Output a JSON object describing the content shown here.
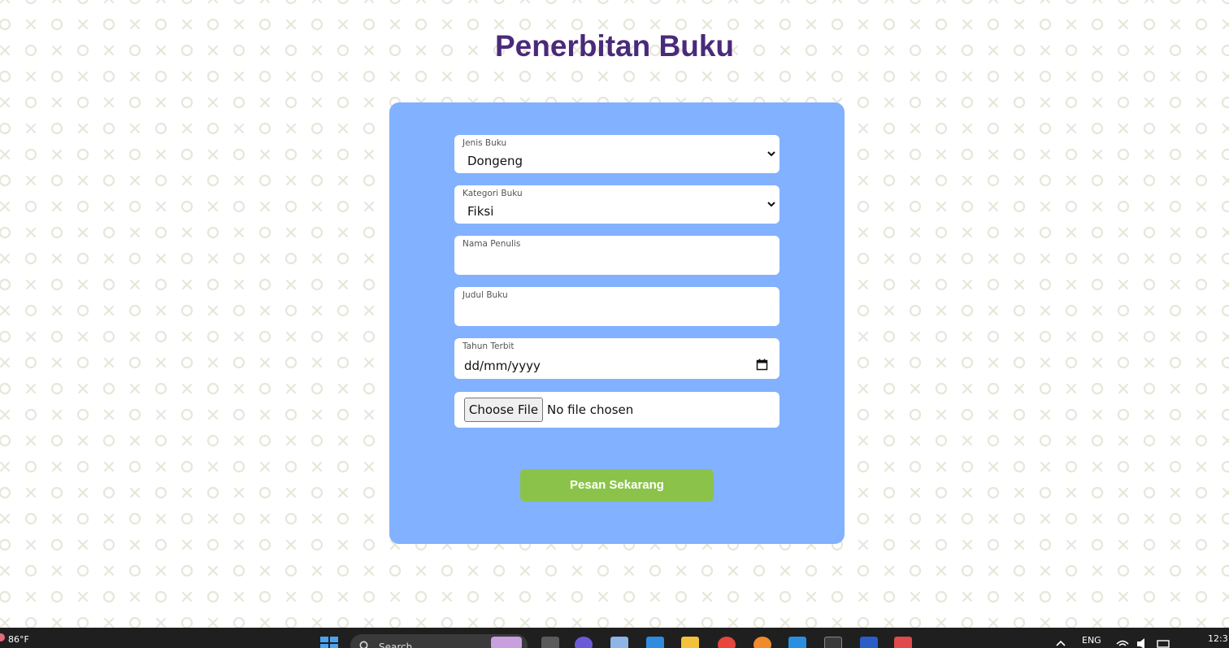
{
  "page": {
    "title": "Penerbitan Buku"
  },
  "form": {
    "jenis_buku": {
      "label": "Jenis Buku",
      "value": "Dongeng"
    },
    "kategori_buku": {
      "label": "Kategori Buku",
      "value": "Fiksi"
    },
    "nama_penulis": {
      "label": "Nama Penulis",
      "value": ""
    },
    "judul_buku": {
      "label": "Judul Buku",
      "value": ""
    },
    "tahun_terbit": {
      "label": "Tahun Terbit",
      "placeholder": "dd/mm/yyyy"
    },
    "file": {
      "button_label": "Choose File",
      "status": "No file chosen"
    },
    "submit_label": "Pesan Sekarang"
  },
  "colors": {
    "title": "#4a2a7a",
    "card": "#82b1ff",
    "submit": "#8bc34a",
    "pattern": "#e9e9dd"
  },
  "taskbar": {
    "weather": "86°F",
    "search_placeholder": "Search",
    "language": "ENG",
    "clock": "12:3",
    "apps": [
      "file-explorer-icon",
      "chat-icon",
      "photos-icon",
      "mail-icon",
      "folder-icon",
      "chrome-icon",
      "firefox-icon",
      "vscode-icon",
      "terminal-icon",
      "word-icon",
      "snipping-tool-icon"
    ]
  }
}
